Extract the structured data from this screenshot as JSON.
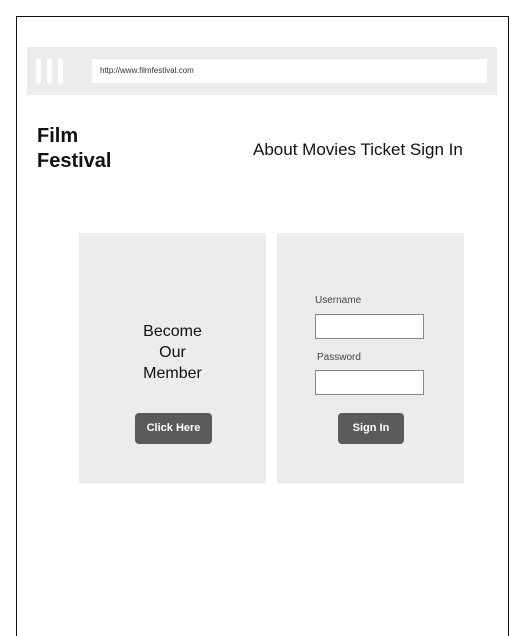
{
  "browser": {
    "url": "http://www.filmfestival.com"
  },
  "header": {
    "logo_line1": "Film",
    "logo_line2": "Festival",
    "nav": [
      "About",
      "Movies",
      "Ticket",
      "Sign In"
    ]
  },
  "member_panel": {
    "line1": "Become",
    "line2": "Our",
    "line3": "Member",
    "button_label": "Click Here"
  },
  "login_panel": {
    "username_label": "Username",
    "username_value": "",
    "password_label": "Password",
    "password_value": "",
    "button_label": "Sign In"
  },
  "colors": {
    "panel_bg": "#ececec",
    "button_bg": "#5a5a5a"
  }
}
